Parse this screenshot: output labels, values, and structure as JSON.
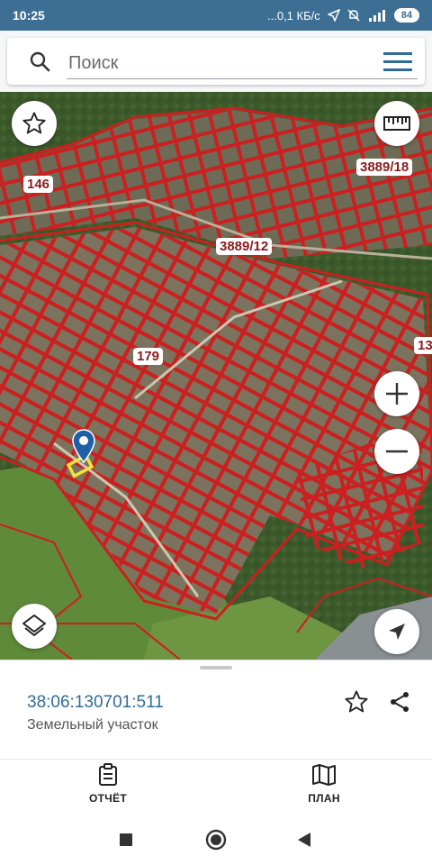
{
  "status_bar": {
    "time": "10:25",
    "speed": "...0,1 КБ/с",
    "battery": "84"
  },
  "search": {
    "placeholder": "Поиск"
  },
  "map": {
    "labels": [
      "146",
      "3889/18",
      "3889/12",
      "179",
      "13"
    ],
    "marker_color": "#1f5fa8",
    "selected_parcel_color": "#f3e23a",
    "boundary_color": "#cc1f1f"
  },
  "parcel": {
    "cadastral_number": "38:06:130701:511",
    "type": "Земельный участок"
  },
  "tabs": [
    {
      "label": "ОТЧЁТ",
      "icon": "report-icon"
    },
    {
      "label": "ПЛАН",
      "icon": "map-plan-icon"
    }
  ],
  "colors": {
    "status_bar": "#3d6f94",
    "accent": "#2f6c98"
  }
}
